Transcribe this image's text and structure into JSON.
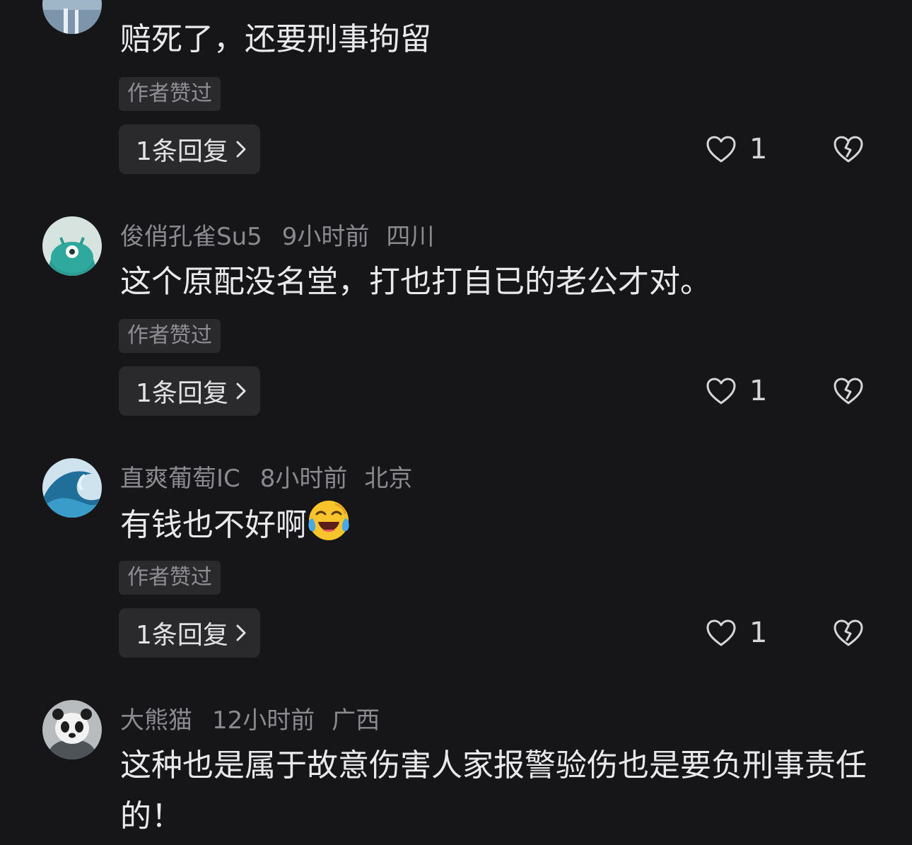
{
  "comments": [
    {
      "username": "",
      "time": "",
      "location": "",
      "text": "赔死了，还要刑事拘留",
      "author_tag": "作者赞过",
      "reply_label": "1条回复",
      "likes": "1",
      "avatar_icon": "avatar-partial-icon"
    },
    {
      "username": "俊俏孔雀Su5",
      "time": "9小时前",
      "location": "四川",
      "text": "这个原配没名堂，打也打自已的老公才对。",
      "author_tag": "作者赞过",
      "reply_label": "1条回复",
      "likes": "1",
      "avatar_icon": "teal-monster-avatar-icon"
    },
    {
      "username": "直爽葡萄IC",
      "time": "8小时前",
      "location": "北京",
      "text": "有钱也不好啊",
      "emoji": "laughing-crying-emoji",
      "author_tag": "作者赞过",
      "reply_label": "1条回复",
      "likes": "1",
      "avatar_icon": "wave-avatar-icon"
    },
    {
      "username": "大熊猫",
      "time": "12小时前",
      "location": "广西",
      "text": "这种也是属于故意伤害人家报警验伤也是要负刑事责任的！",
      "avatar_icon": "panda-avatar-icon"
    }
  ],
  "colors": {
    "background": "#161618",
    "chip": "#2a2a2d",
    "meta": "#8a8a8f",
    "text": "#e9e9ec"
  }
}
